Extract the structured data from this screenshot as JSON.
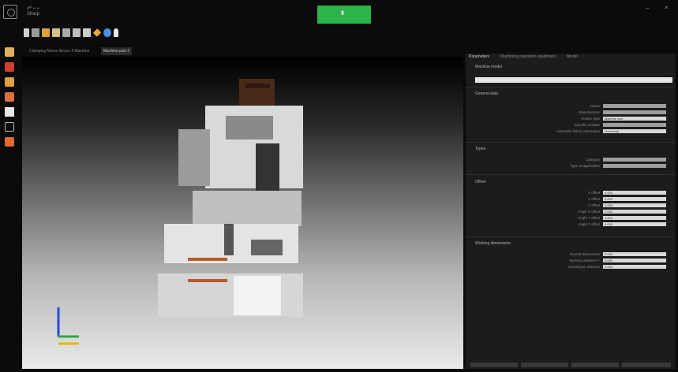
{
  "app": {
    "title_line1": "☍ ⌐ ⌐",
    "title_line2": "Sharp"
  },
  "header": {
    "center_button_label": "▮"
  },
  "window": {
    "minimize": "–",
    "close": "×"
  },
  "toolbar": {
    "icons": [
      "cursor-icon",
      "frame-icon",
      "folder-icon",
      "save-icon",
      "copy-icon",
      "cut-icon",
      "paste-icon",
      "diamond-icon",
      "globe-icon",
      "person-icon"
    ]
  },
  "doc_tabs": [
    {
      "label": "Clamping fixture device 2 Machine"
    },
    {
      "label": "Machine part 2"
    }
  ],
  "sidebar": {
    "icons": [
      "part-icon",
      "person-icon",
      "arrow-icon",
      "cylinder-icon",
      "tool-icon",
      "frame-icon",
      "direction-icon"
    ]
  },
  "panel": {
    "tabs": [
      "Parameters",
      "Machining operation equipment",
      "Model"
    ],
    "sections": [
      {
        "title": "Machine model",
        "rows": []
      },
      {
        "title": "General data",
        "rows": [
          {
            "label": "Name",
            "value": ""
          },
          {
            "label": "Manufacturer",
            "value": ""
          },
          {
            "label": "Fixture type",
            "value": "Machine vise"
          },
          {
            "label": "Specific number",
            "value": ""
          },
          {
            "label": "Assembly fixture orientation",
            "value": "Horizontal"
          }
        ]
      },
      {
        "title": "Types",
        "rows": [
          {
            "label": "Category",
            "value": ""
          },
          {
            "label": "Type of application",
            "value": ""
          }
        ]
      },
      {
        "title": "Offset",
        "rows": [
          {
            "label": "X offset",
            "value": "0.000"
          },
          {
            "label": "Y offset",
            "value": "0.000"
          },
          {
            "label": "Z offset",
            "value": "0.000"
          },
          {
            "label": "Angle X offset",
            "value": "0.000"
          },
          {
            "label": "Angle Y offset",
            "value": "0.000"
          },
          {
            "label": "Angle Z offset",
            "value": "0.000"
          }
        ]
      },
      {
        "title": "Working dimensions",
        "rows": [
          {
            "label": "Overall dimensions",
            "value": "0.000"
          },
          {
            "label": "Working distance Y",
            "value": "0.000"
          },
          {
            "label": "Overall jaw distance",
            "value": "0.000"
          }
        ]
      }
    ]
  },
  "colors": {
    "accent": "#2cb34a",
    "panel_bg": "#1c1c1c"
  }
}
